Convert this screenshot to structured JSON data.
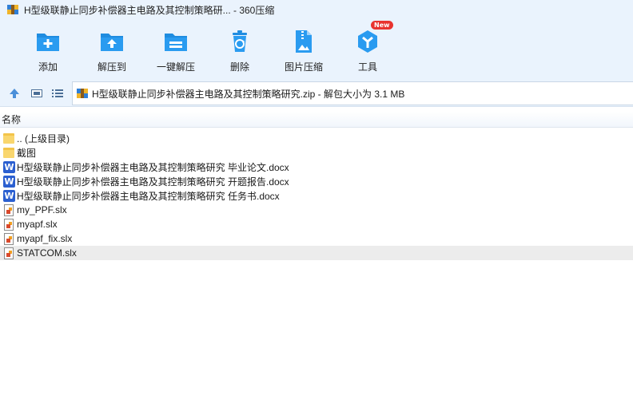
{
  "window": {
    "title": "H型级联静止同步补偿器主电路及其控制策略研...  - 360压缩"
  },
  "toolbar": {
    "items": [
      {
        "label": "添加",
        "icon": "add-icon"
      },
      {
        "label": "解压到",
        "icon": "extract-to-icon"
      },
      {
        "label": "一键解压",
        "icon": "one-click-extract-icon"
      },
      {
        "label": "删除",
        "icon": "delete-icon"
      },
      {
        "label": "图片压缩",
        "icon": "image-compress-icon"
      },
      {
        "label": "工具",
        "icon": "tools-icon",
        "badge": "New"
      }
    ]
  },
  "address": {
    "path": "H型级联静止同步补偿器主电路及其控制策略研究.zip - 解包大小为 3.1 MB"
  },
  "list": {
    "column_name": "名称",
    "files": [
      {
        "name": ".. (上级目录)",
        "type": "folder"
      },
      {
        "name": "截图",
        "type": "folder"
      },
      {
        "name": "H型级联静止同步补偿器主电路及其控制策略研究 毕业论文.docx",
        "type": "word"
      },
      {
        "name": "H型级联静止同步补偿器主电路及其控制策略研究 开题报告.docx",
        "type": "word"
      },
      {
        "name": "H型级联静止同步补偿器主电路及其控制策略研究 任务书.docx",
        "type": "word"
      },
      {
        "name": "my_PPF.slx",
        "type": "slx"
      },
      {
        "name": "myapf.slx",
        "type": "slx"
      },
      {
        "name": "myapf_fix.slx",
        "type": "slx"
      },
      {
        "name": "STATCOM.slx",
        "type": "slx",
        "selected": true
      }
    ]
  },
  "colors": {
    "toolbar_bg": "#eaf3fd",
    "icon_blue": "#1f8ce0",
    "badge_red": "#e8332f",
    "selected_row": "#ececec"
  }
}
